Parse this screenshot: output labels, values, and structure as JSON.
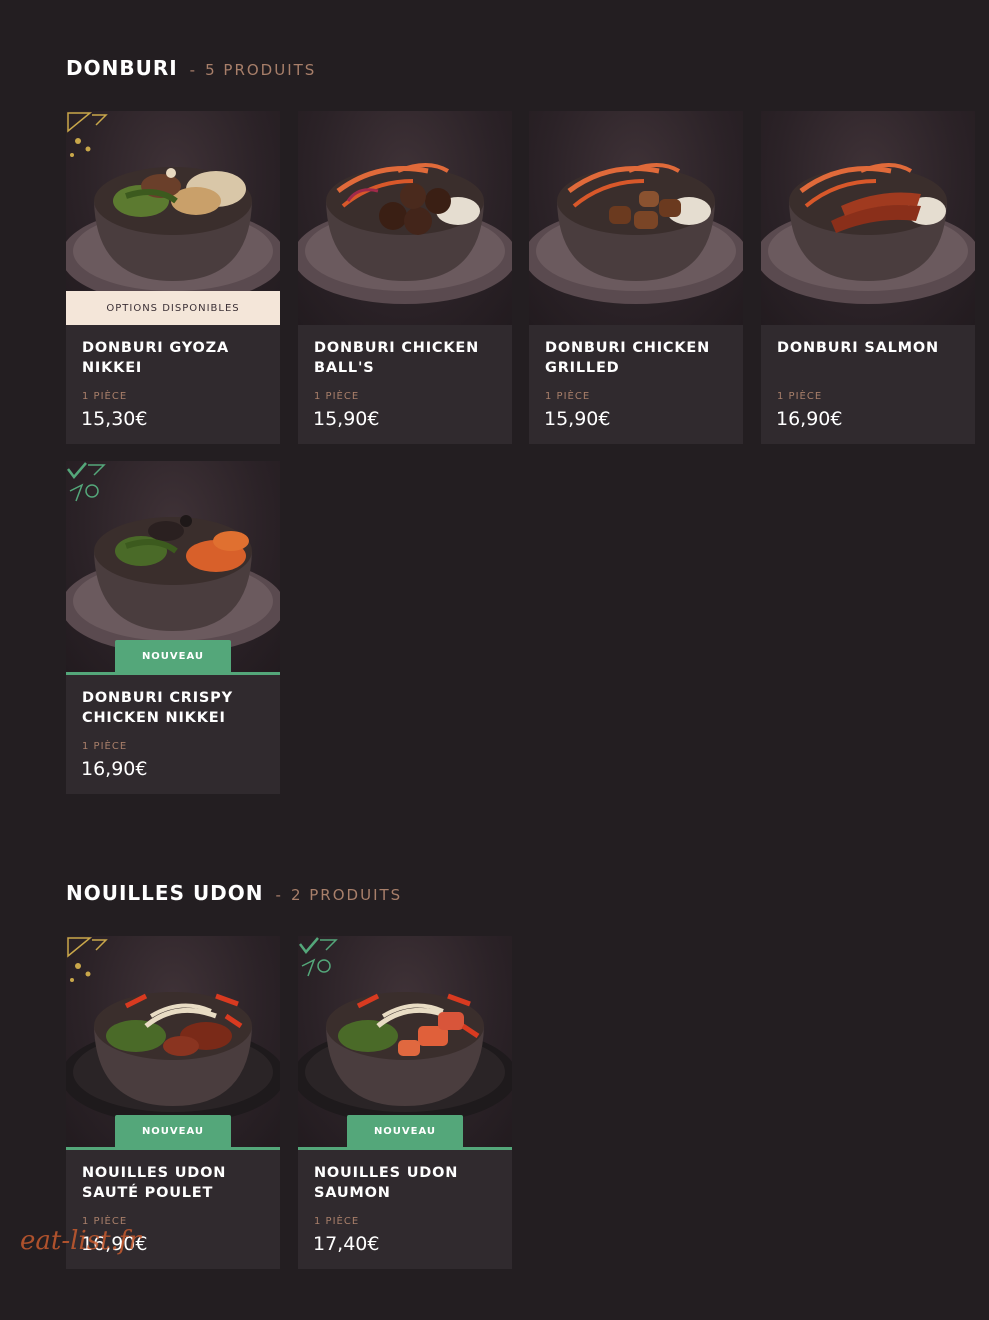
{
  "sections": [
    {
      "title": "DONBURI",
      "separator": "-",
      "count": "5 PRODUITS",
      "products": [
        {
          "name": "DONBURI GYOZA NIKKEI",
          "qty": "1 PIÈCE",
          "price": "15,30€",
          "badge": "OPTIONS DISPONIBLES"
        },
        {
          "name": "DONBURI CHICKEN BALL'S",
          "qty": "1 PIÈCE",
          "price": "15,90€"
        },
        {
          "name": "DONBURI CHICKEN GRILLED",
          "qty": "1 PIÈCE",
          "price": "15,90€"
        },
        {
          "name": "DONBURI SALMON",
          "qty": "1 PIÈCE",
          "price": "16,90€"
        },
        {
          "name": "DONBURI CRISPY CHICKEN NIKKEI",
          "qty": "1 PIÈCE",
          "price": "16,90€",
          "badge": "NOUVEAU"
        }
      ]
    },
    {
      "title": "NOUILLES UDON",
      "separator": "-",
      "count": "2 PRODUITS",
      "products": [
        {
          "name": "NOUILLES UDON SAUTÉ POULET",
          "qty": "1 PIÈCE",
          "price": "16,90€",
          "badge": "NOUVEAU"
        },
        {
          "name": "NOUILLES UDON SAUMON",
          "qty": "1 PIÈCE",
          "price": "17,40€",
          "badge": "NOUVEAU"
        }
      ]
    }
  ],
  "watermark": "eat-list.fr",
  "colors": {
    "background": "#231e21",
    "card": "#302a2e",
    "accent_copper": "#a87f6a",
    "new_green": "#54a77a",
    "options_cream": "#f4e6d9"
  },
  "icons": {
    "spicy_deco": "chili-deco-icon",
    "veggie_deco": "check-leaf-deco-icon"
  }
}
